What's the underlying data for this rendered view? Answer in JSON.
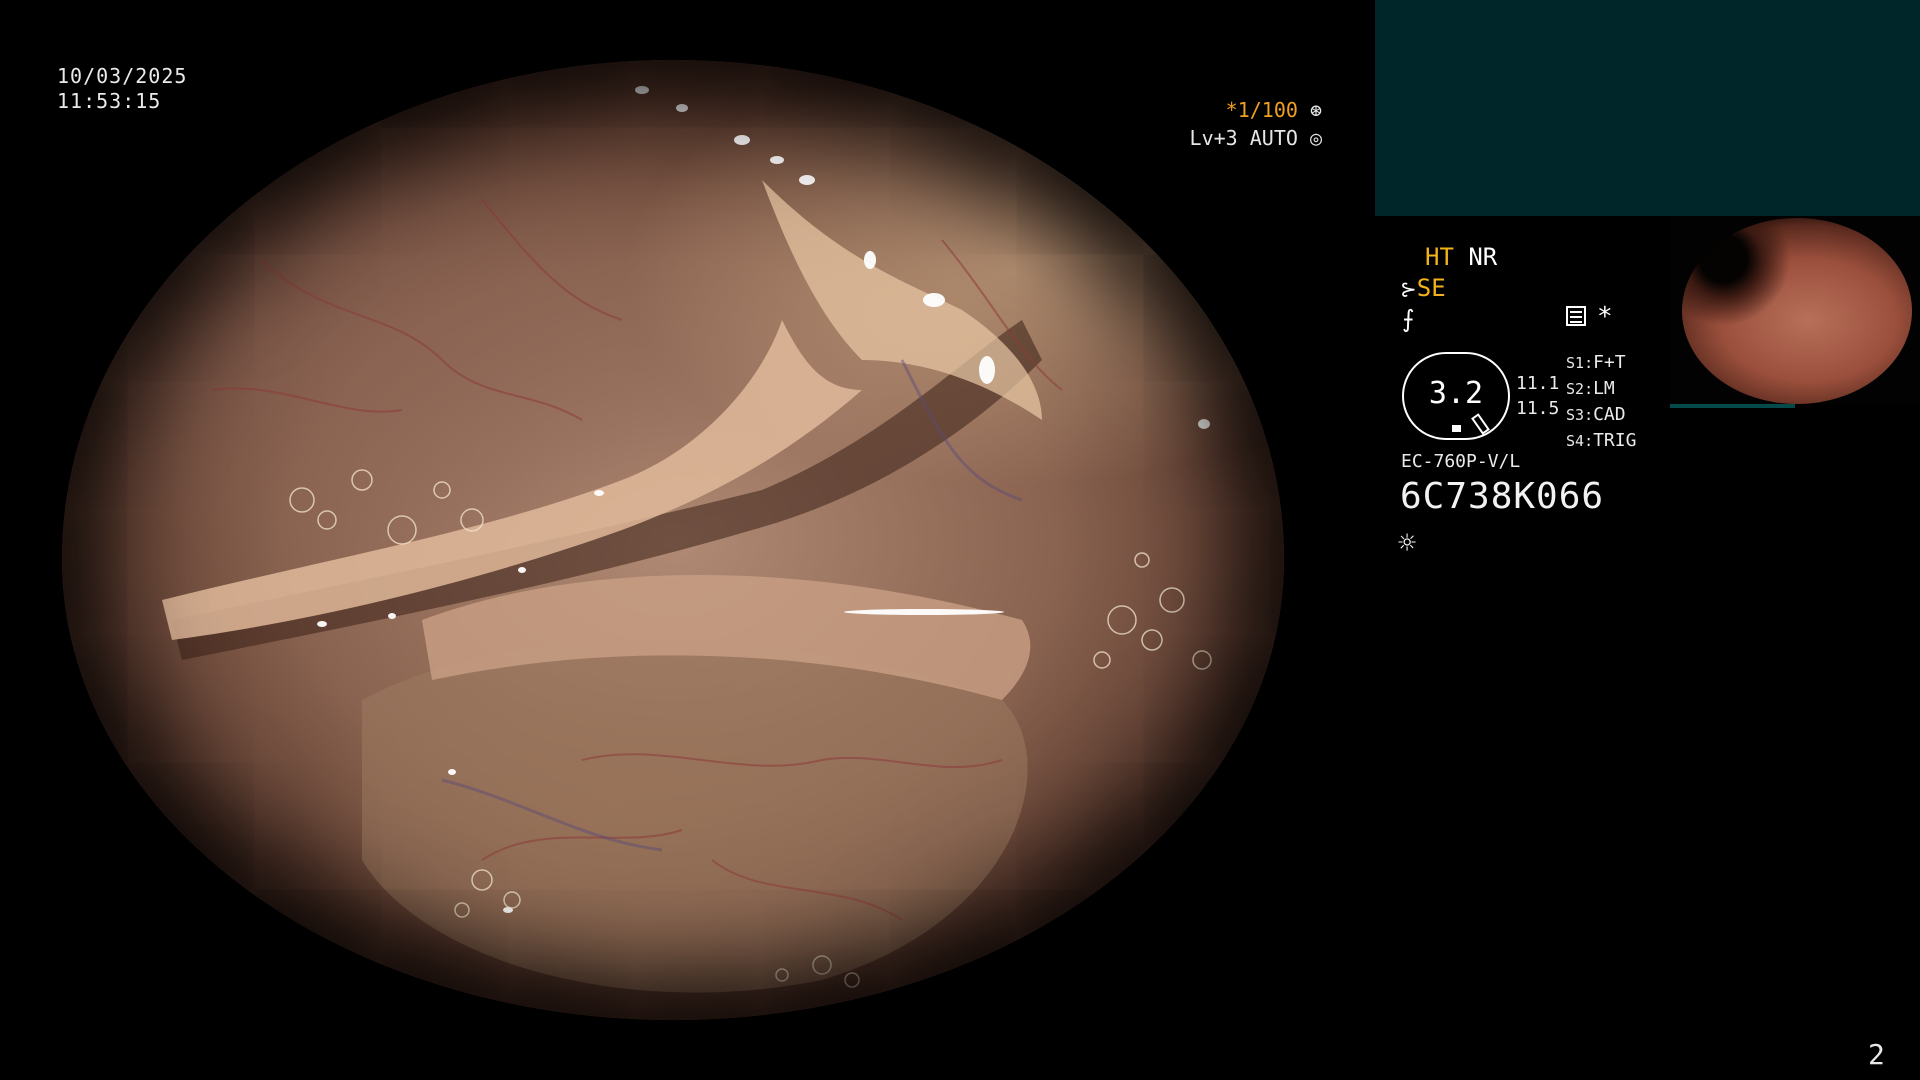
{
  "overlay": {
    "date": "10/03/2025",
    "time": "11:53:15",
    "shutter": "*1/100",
    "level": "Lv+3 AUTO",
    "page_number": "2"
  },
  "panel": {
    "enhance_1": "HT",
    "enhance_2": "NR",
    "se_label": "SE",
    "freeze_symbol": "⨍",
    "star_symbol": "*",
    "zoom_value": "3.2",
    "values": [
      "11.1",
      "11.5"
    ],
    "switches": [
      {
        "key": "S1",
        "label": "F+T"
      },
      {
        "key": "S2",
        "label": "LM"
      },
      {
        "key": "S3",
        "label": "CAD"
      },
      {
        "key": "S4",
        "label": "TRIG"
      }
    ],
    "scope_model": "EC-760P-V/L",
    "serial": "6C738K066"
  },
  "colors": {
    "accent_orange": "#f0a020",
    "panel_teal": "#012629",
    "label_yellow": "#f2b21b"
  },
  "icons": [
    "shutter-icon",
    "auto-iris-icon",
    "scope-icon",
    "freeze-icon",
    "setting-icon",
    "light-icon"
  ]
}
